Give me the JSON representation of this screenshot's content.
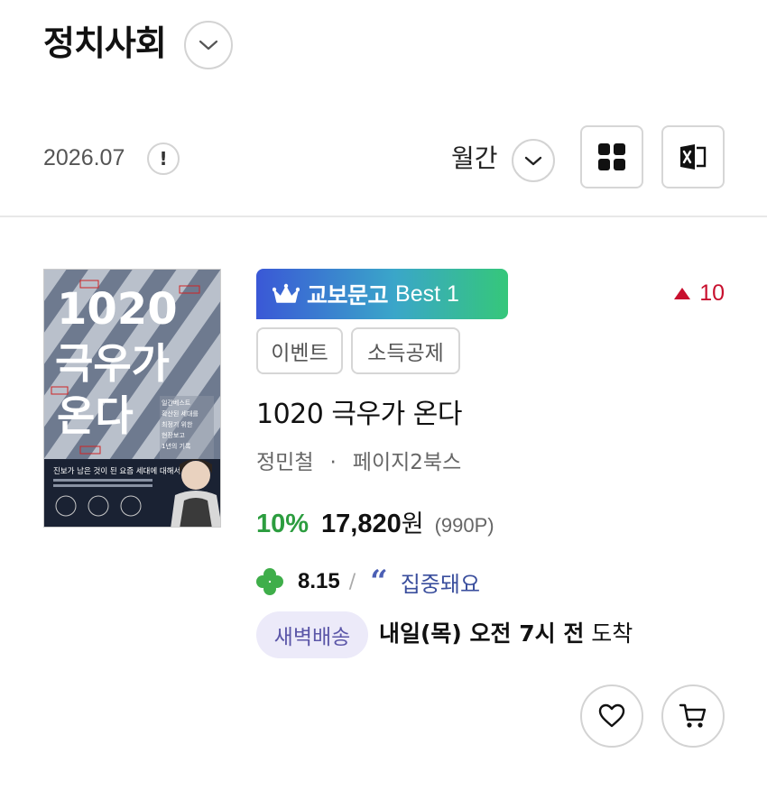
{
  "header": {
    "category_title": "정치사회",
    "period": "2026.07",
    "info_icon_text": "!",
    "period_select": "월간"
  },
  "icons": {
    "category_toggle": "chevron-down-icon",
    "info": "exclamation-icon",
    "period_toggle": "chevron-down-icon",
    "grid_view": "grid-view-icon",
    "excel_download": "excel-icon",
    "best_crown": "crown-icon",
    "rank_up": "triangle-up-icon",
    "rating": "clover-icon",
    "review_quote": "quote-icon",
    "wishlist": "heart-icon",
    "cart": "cart-icon"
  },
  "book": {
    "badge_text": "교보문고",
    "badge_best": "Best 1",
    "rank_change": "10",
    "tags": [
      "이벤트",
      "소득공제"
    ],
    "title": "1020 극우가 온다",
    "author": "정민철",
    "separator": "·",
    "publisher": "페이지2북스",
    "discount": "10%",
    "price": "17,820",
    "currency": "원",
    "points": "(990P)",
    "rating": "8.15",
    "rating_sep": "/",
    "review_keyword": "집중돼요",
    "delivery_badge": "새벽배송",
    "arrival_bold": "내일(목) 오전 7시 전",
    "arrival_rest": " 도착",
    "cover": {
      "title_line1": "1020",
      "title_line2": "극우가",
      "title_line3": "온다",
      "subtitle": "진보가 남은 것이 된 요즘 세대에 대해서",
      "side_text": "일간베스트 확산된 세대를 최정기 위한 현장보고 1년의 기록"
    }
  },
  "colors": {
    "accent_green": "#2c9d3f",
    "rank_red": "#c8102e",
    "review_blue": "#3a4e9d",
    "badge_gradient_start": "#3a58d6",
    "badge_gradient_end": "#35c77a"
  }
}
